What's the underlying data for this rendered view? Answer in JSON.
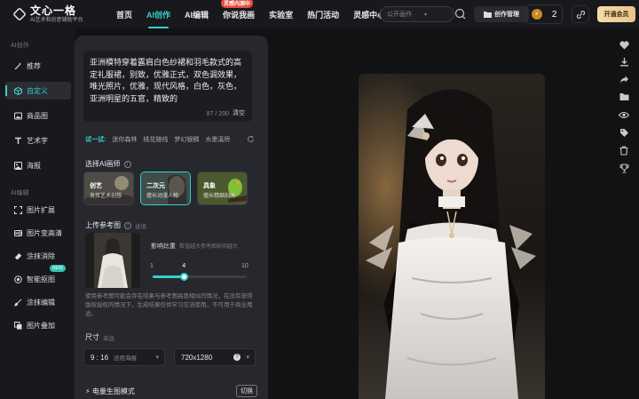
{
  "header": {
    "logo_title": "文心一格",
    "logo_subtitle": "AI艺术和创意辅助平台",
    "nav": [
      {
        "label": "首页",
        "active": false
      },
      {
        "label": "AI创作",
        "active": true
      },
      {
        "label": "AI编辑",
        "active": false
      },
      {
        "label": "你说我画",
        "active": false,
        "badge": "灵感内测中"
      },
      {
        "label": "实验室",
        "active": false
      },
      {
        "label": "热门活动",
        "active": false
      },
      {
        "label": "灵感中心",
        "active": false
      }
    ],
    "search_placeholder": "公开画作",
    "create_mgmt_label": "创作管理",
    "coin_count": "2",
    "vip_label": "开通会员"
  },
  "sidebar": {
    "group1_label": "AI创作",
    "group1_items": [
      {
        "label": "推荐",
        "icon": "magic-wand-icon",
        "active": false
      },
      {
        "label": "自定义",
        "icon": "cube-icon",
        "active": true
      },
      {
        "label": "商品图",
        "icon": "image-icon",
        "active": false
      },
      {
        "label": "艺术字",
        "icon": "text-icon",
        "active": false
      },
      {
        "label": "海报",
        "icon": "poster-icon",
        "active": false
      }
    ],
    "group2_label": "AI编辑",
    "group2_items": [
      {
        "label": "图片扩展",
        "icon": "expand-icon"
      },
      {
        "label": "图片变高清",
        "icon": "hd-icon"
      },
      {
        "label": "涂抹消除",
        "icon": "eraser-icon"
      },
      {
        "label": "智能抠图",
        "icon": "cutout-icon",
        "badge": "NEW"
      },
      {
        "label": "涂抹编辑",
        "icon": "brush-icon"
      },
      {
        "label": "图片叠加",
        "icon": "layers-icon"
      }
    ]
  },
  "panel": {
    "prompt_text": "亚洲模特穿着露肩白色纱裙和羽毛款式的高定礼服裙，别致，优雅正式，双色调效果，唯光照片，优雅，现代风格，白色，灰色，亚洲明星的五官，精致的",
    "prompt_count": "87 / 200",
    "prompt_clear": "清空",
    "try_label": "试一试:",
    "try_items": [
      "迷你森林",
      "桃花随线",
      "梦幻银鳞",
      "水墨溪桥"
    ],
    "painter_section": "选择AI画师",
    "painters": [
      {
        "name": "创艺",
        "desc": "发挥艺术创想",
        "active": false
      },
      {
        "name": "二次元",
        "desc": "擅长动漫人物",
        "active": true
      },
      {
        "name": "具象",
        "desc": "擅长精细刻画",
        "active": false
      }
    ],
    "ref_section": "上传参考图",
    "ref_hint": "选填",
    "influence_label": "影响比重",
    "influence_hint": "数值越大参考图影响越大",
    "slider": {
      "min": "1",
      "value": "4",
      "max": "10",
      "fraction": 0.333
    },
    "ref_note": "使用参考图可能会存在结果与参考图高度相似的情况，在没有获得版权授权的情况下，生成结果仅供学习交流使用，不可用于商业用途。",
    "size_section": "尺寸",
    "size_hint": "单选",
    "ratio": "9 : 16",
    "ratio_desc": "适用海报",
    "resolution": "720x1280",
    "speed_label": "⚡ 电量生图模式",
    "switch_label": "切换"
  }
}
